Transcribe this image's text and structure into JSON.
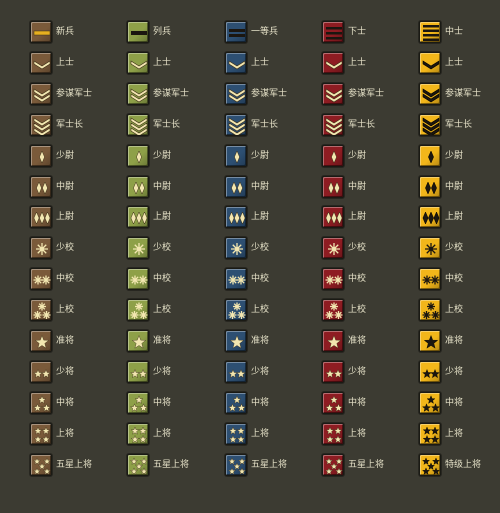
{
  "palette": {
    "brown": "#7a5a3a",
    "green": "#8ea048",
    "blue": "#2d4f72",
    "red": "#8e1c22",
    "gold": "#f2b61a"
  },
  "columns": [
    "brown",
    "green",
    "blue",
    "red",
    "gold"
  ],
  "rows": [
    {
      "insignia": "bars-1",
      "labels": [
        "新兵",
        "列兵",
        "一等兵",
        "下士",
        "中士"
      ],
      "col_insignia": [
        "bar-gold",
        "bar-dark",
        "bar-double",
        "bar-triple",
        "bar-quad"
      ]
    },
    {
      "insignia": "chevron-1",
      "labels": [
        "上士",
        "上士",
        "上士",
        "上士",
        "上士"
      ]
    },
    {
      "insignia": "chevron-2",
      "labels": [
        "参谋军士",
        "参谋军士",
        "参谋军士",
        "参谋军士",
        "参谋军士"
      ]
    },
    {
      "insignia": "chevron-3",
      "labels": [
        "军士长",
        "军士长",
        "军士长",
        "军士长",
        "军士长"
      ]
    },
    {
      "insignia": "diamond-1",
      "labels": [
        "少尉",
        "少尉",
        "少尉",
        "少尉",
        "少尉"
      ]
    },
    {
      "insignia": "diamond-2",
      "labels": [
        "中尉",
        "中尉",
        "中尉",
        "中尉",
        "中尉"
      ]
    },
    {
      "insignia": "diamond-3",
      "labels": [
        "上尉",
        "上尉",
        "上尉",
        "上尉",
        "上尉"
      ]
    },
    {
      "insignia": "flower-1",
      "labels": [
        "少校",
        "少校",
        "少校",
        "少校",
        "少校"
      ]
    },
    {
      "insignia": "flower-2",
      "labels": [
        "中校",
        "中校",
        "中校",
        "中校",
        "中校"
      ]
    },
    {
      "insignia": "flower-3",
      "labels": [
        "上校",
        "上校",
        "上校",
        "上校",
        "上校"
      ]
    },
    {
      "insignia": "star-1",
      "labels": [
        "准将",
        "准将",
        "准将",
        "准将",
        "准将"
      ]
    },
    {
      "insignia": "star-2",
      "labels": [
        "少将",
        "少将",
        "少将",
        "少将",
        "少将"
      ]
    },
    {
      "insignia": "star-3",
      "labels": [
        "中将",
        "中将",
        "中将",
        "中将",
        "中将"
      ]
    },
    {
      "insignia": "star-4",
      "labels": [
        "上将",
        "上将",
        "上将",
        "上将",
        "上将"
      ]
    },
    {
      "insignia": "star-5",
      "labels": [
        "五星上将",
        "五星上将",
        "五星上将",
        "五星上将",
        "特级上将"
      ]
    }
  ]
}
